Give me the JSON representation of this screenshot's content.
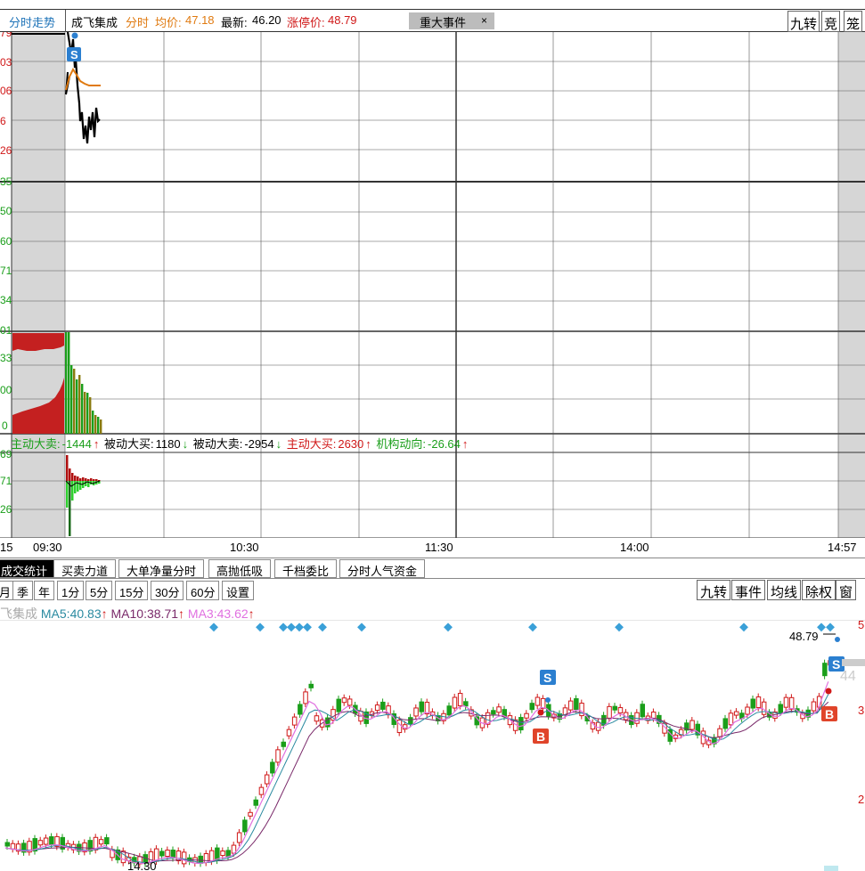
{
  "header": {
    "active_tab": "分时走势",
    "stock_name": "成飞集成",
    "mode": "分时",
    "avg_label": "均价:",
    "avg_value": "47.18",
    "last_label": "最新:",
    "last_value": "46.20",
    "limit_label": "涨停价:",
    "limit_value": "48.79",
    "news_button": "重大事件",
    "close_symbol": "×",
    "right_buttons": [
      "九转",
      "竞",
      "笼"
    ]
  },
  "price_axis_labels": [
    "79",
    "03",
    "06",
    "6",
    "26",
    "35"
  ],
  "volume_axis_labels": [
    "50",
    "60",
    "71",
    "34"
  ],
  "depth_axis_labels": [
    "01",
    "33",
    "00",
    "0"
  ],
  "flow_axis_labels": [
    "69",
    "71",
    "26"
  ],
  "flow": {
    "items": [
      {
        "label": "主动大卖:",
        "value": "-1444",
        "arrow": "↑",
        "color": "#1a9e1a"
      },
      {
        "label": "被动大买:",
        "value": "1180",
        "arrow": "↓",
        "color": "#000000"
      },
      {
        "label": "被动大卖:",
        "value": "-2954",
        "arrow": "↓",
        "color": "#000000"
      },
      {
        "label": "主动大买:",
        "value": "2630",
        "arrow": "↑",
        "color": "#d01818"
      },
      {
        "label": "机构动向:",
        "value": "-26.64",
        "arrow": "↑",
        "color": "#1a9e1a"
      }
    ]
  },
  "time_axis": [
    "15",
    "09:30",
    "10:30",
    "11:30",
    "14:00",
    "14:57"
  ],
  "bottom_tabs": [
    "成交统计",
    "买卖力道",
    "大单净量分时",
    "高抛低吸",
    "千档委比",
    "分时人气资金"
  ],
  "periods": [
    "月",
    "季",
    "年",
    "1分",
    "5分",
    "15分",
    "30分",
    "60分",
    "设置"
  ],
  "kline_buttons": [
    "九转",
    "事件",
    "均线",
    "除权",
    "窗"
  ],
  "ma": {
    "name": "飞集成",
    "ma5_label": "MA5:",
    "ma5": "40.83",
    "ma10_label": "MA10:",
    "ma10": "38.71",
    "ma3_label": "MA3:",
    "ma3": "43.62",
    "arrow": "↑"
  },
  "kline_labels": {
    "high": "48.79",
    "low": "14.30",
    "right_axis": [
      "5",
      "44",
      "3",
      "2"
    ],
    "buy_marker": "B",
    "sell_marker": "S"
  },
  "colors": {
    "up": "#d01818",
    "down": "#1a9e1a",
    "ma5": "#2a8aa0",
    "ma10": "#7a2a6a",
    "ma3": "#e070e0",
    "avg_line": "#e07a10",
    "blue_marker": "#2b7fd0",
    "news_marker": "#3aa0d8"
  }
}
